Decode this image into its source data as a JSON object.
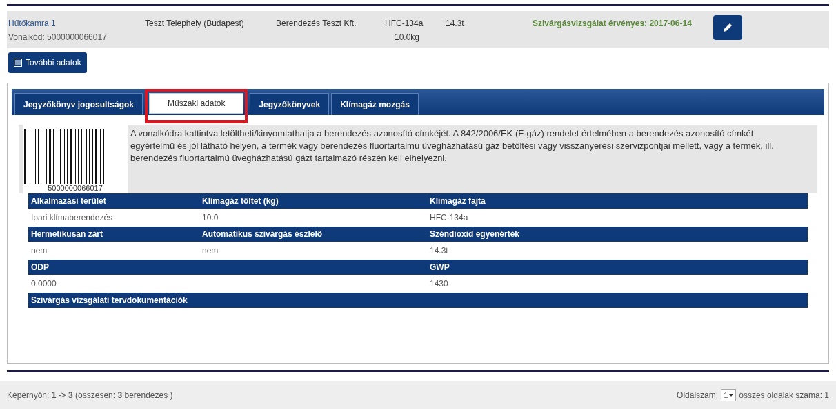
{
  "equipment": {
    "name": "Hűtőkamra 1",
    "barcode_label": "Vonalkód: 5000000066017",
    "site": "Teszt Telephely (Budapest)",
    "company": "Berendezés Teszt Kft.",
    "gas": "HFC-134a",
    "charge": "10.0kg",
    "co2": "14.3t",
    "status": "Szivárgásvizsgálat érvényes: 2017-06-14"
  },
  "more_button": "További adatok",
  "tabs": [
    {
      "label": "Jegyzőkönyv jogosultságok",
      "selected": false,
      "highlighted": false
    },
    {
      "label": "Műszaki adatok",
      "selected": true,
      "highlighted": true
    },
    {
      "label": "Jegyzőkönyvek",
      "selected": false,
      "highlighted": false
    },
    {
      "label": "Klímagáz mozgás",
      "selected": false,
      "highlighted": false
    }
  ],
  "barcode_number": "5000000066017",
  "info_text": "A vonalkódra kattintva letöltheti/kinyomtathatja a berendezés azonosító címkéjét. A 842/2006/EK (F-gáz) rendelet értelmében a berendezés azonosító címkét egyértelmű és jól látható helyen, a termék vagy berendezés fluortartalmú üvegházhatású gáz betöltési vagy visszanyerési szervizpontjai mellett, vagy a termék, ill. berendezés fluortartalmú üvegházhatású gázt tartalmazó részén kell elhelyezni.",
  "sections": [
    {
      "headers": [
        "Alkalmazási terület",
        "Klímagáz töltet (kg)",
        "Klímagáz fajta"
      ],
      "values": [
        "Ipari klímaberendezés",
        "10.0",
        "HFC-134a"
      ]
    },
    {
      "headers": [
        "Hermetikusan zárt",
        "Automatikus szivárgás észlelő",
        "Széndioxid egyenérték"
      ],
      "values": [
        "nem",
        "nem",
        "14.3t"
      ]
    },
    {
      "headers": [
        "ODP",
        "GWP"
      ],
      "values": [
        "0.0000",
        "1430"
      ]
    },
    {
      "headers": [
        "Szivárgás vizsgálati tervdokumentációk"
      ]
    }
  ],
  "footer": {
    "summary": "Képernyőn: **1** -> **3** (összesen: **3** berendezés )",
    "page_label": "Oldalszám:",
    "page_value": "1",
    "total_label": "összes oldalak száma: 1"
  }
}
